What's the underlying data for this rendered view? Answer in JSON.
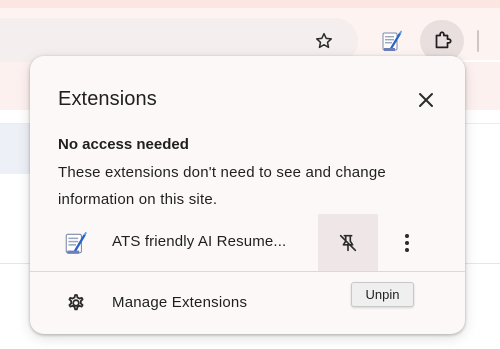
{
  "popup": {
    "title": "Extensions",
    "section_heading": "No access needed",
    "section_description": "These extensions don't need to see and change information on this site.",
    "extension": {
      "name": "ATS friendly AI Resume...",
      "icon": "quill-document-icon",
      "pin_state": "pinned"
    },
    "manage_label": "Manage Extensions"
  },
  "toolbar": {
    "icons": [
      "star-icon",
      "ats-resume-extension-icon",
      "puzzle-icon"
    ]
  },
  "tooltip": {
    "text": "Unpin"
  },
  "colors": {
    "popup_bg": "#fdf8f8",
    "toolbar_bg": "#fdf4f2",
    "text": "#1f1f1f",
    "extension_icon_blue": "#2a63c8"
  }
}
